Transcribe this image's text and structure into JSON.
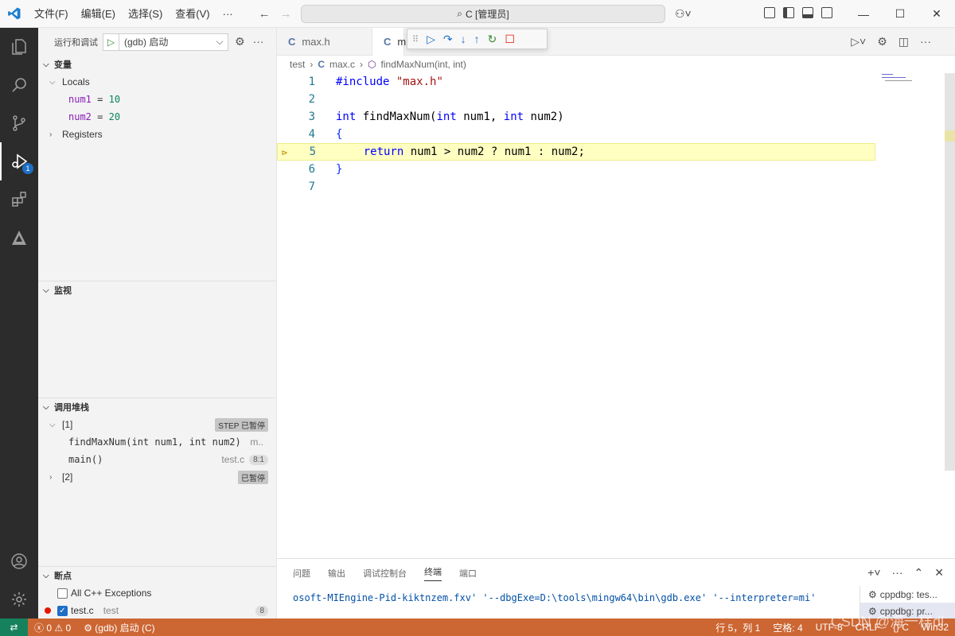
{
  "titlebar": {
    "menus": [
      "文件(F)",
      "编辑(E)",
      "选择(S)",
      "查看(V)",
      "···"
    ],
    "command_center": "C [管理员]"
  },
  "activity_bar": {
    "items": [
      "files-icon",
      "search-icon",
      "source-control-icon",
      "run-debug-icon",
      "extensions-icon",
      "cmake-icon"
    ],
    "debug_badge": "1",
    "bottom": [
      "account-icon",
      "settings-gear-icon"
    ]
  },
  "sidebar": {
    "toolbar_label": "运行和调试",
    "config_name": "(gdb) 启动",
    "variables": {
      "header": "变量",
      "locals_label": "Locals",
      "locals": [
        {
          "name": "num1",
          "value": "10"
        },
        {
          "name": "num2",
          "value": "20"
        }
      ],
      "registers_label": "Registers"
    },
    "watch_header": "监视",
    "call_stack": {
      "header": "调用堆栈",
      "threads": [
        {
          "label": "[1]",
          "state": "STEP 已暂停",
          "expanded": true,
          "frames": [
            {
              "name": "findMaxNum(int num1, int num2)",
              "file": "m..",
              "line": ""
            },
            {
              "name": "main()",
              "file": "test.c",
              "line": "8:1"
            }
          ]
        },
        {
          "label": "[2]",
          "state": "已暂停",
          "expanded": false,
          "frames": []
        }
      ]
    },
    "breakpoints": {
      "header": "断点",
      "items": [
        {
          "label": "All C++ Exceptions",
          "checked": false
        },
        {
          "label": "test.c",
          "folder": "test",
          "count": "8",
          "checked": true
        }
      ]
    }
  },
  "editor": {
    "tabs": [
      {
        "label": "max.h",
        "active": false
      },
      {
        "label": "m",
        "active": true
      }
    ],
    "breadcrumb": [
      "test",
      "max.c",
      "findMaxNum(int, int)"
    ],
    "code": [
      {
        "n": "1",
        "text": "#include \"max.h\""
      },
      {
        "n": "2",
        "text": ""
      },
      {
        "n": "3",
        "text": "int findMaxNum(int num1, int num2)"
      },
      {
        "n": "4",
        "text": "{"
      },
      {
        "n": "5",
        "text": "    return num1 > num2 ? num1 : num2;",
        "highlight": true
      },
      {
        "n": "6",
        "text": "}"
      },
      {
        "n": "7",
        "text": ""
      }
    ]
  },
  "panel": {
    "tabs": [
      "问题",
      "输出",
      "调试控制台",
      "终端",
      "端口"
    ],
    "active_tab": "终端",
    "terminal_output": "osoft-MIEngine-Pid-kiktnzem.fxv' '--dbgExe=D:\\tools\\mingw64\\bin\\gdb.exe' '--interpreter=mi'",
    "terminals": [
      "cppdbg: tes...",
      "cppdbg: pr..."
    ]
  },
  "statusbar": {
    "errors": "0",
    "warnings": "0",
    "debug_config": "(gdb) 启动 (C)",
    "position": "行 5，列 1",
    "spaces": "空格: 4",
    "encoding": "UTF-8",
    "eol": "CRLF",
    "language": "{} C",
    "platform": "Win32"
  },
  "watermark": "CSDN @海一样dl",
  "colors": {
    "statusbar": "#cc6633",
    "accent": "#1d6fc6",
    "highlight_line": "#ffffc2"
  }
}
